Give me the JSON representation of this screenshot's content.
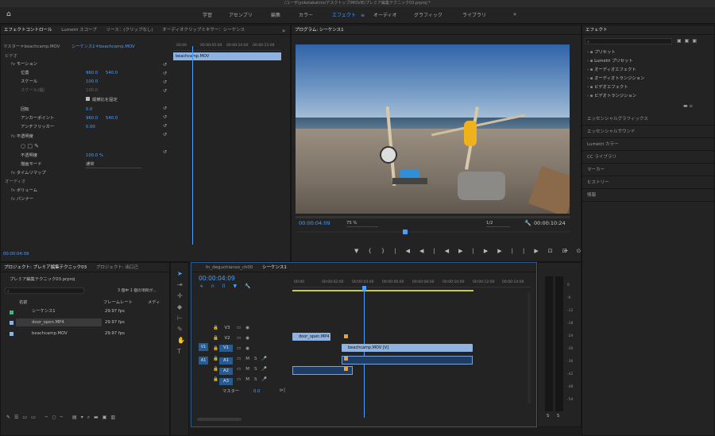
{
  "window": {
    "title": "/ユーザ/yokotakahiro/デスクトップ/MOVIE/プレミア編集テクニック03.prproj *"
  },
  "workspaces": [
    {
      "label": "学習",
      "active": false
    },
    {
      "label": "アセンブリ",
      "active": false
    },
    {
      "label": "編集",
      "active": false
    },
    {
      "label": "カラー",
      "active": false
    },
    {
      "label": "エフェクト",
      "active": true
    },
    {
      "label": "オーディオ",
      "active": false
    },
    {
      "label": "グラフィック",
      "active": false
    },
    {
      "label": "ライブラリ",
      "active": false
    }
  ],
  "effect_controls": {
    "tabs": [
      "エフェクトコントロール",
      "Lumetri スコープ",
      "ソース：(クリップなし)",
      "オーディオクリップミキサー：シーケンス"
    ],
    "source": "マスター＊beachcamp.MOV",
    "sequence": "シーケンス1＊beachcamp.MOV",
    "clip_label": "beachcamp.MOV",
    "ruler": [
      "00:00",
      "00:00:05:00",
      "00:00:10:00",
      "00:00:15:00"
    ],
    "rows": [
      {
        "label": "ビデオ"
      },
      {
        "label": "モーション"
      },
      {
        "label": "位置",
        "v1": "960.0",
        "v2": "540.0"
      },
      {
        "label": "スケール",
        "v1": "100.0"
      },
      {
        "label": "スケール(幅)",
        "v1": "100.0"
      },
      {
        "label": "縦横比を固定",
        "checkbox": true
      },
      {
        "label": "回転",
        "v1": "0.0"
      },
      {
        "label": "アンカーポイント",
        "v1": "960.0",
        "v2": "540.0"
      },
      {
        "label": "アンチフリッカー",
        "v1": "0.00"
      },
      {
        "label": "不透明度"
      },
      {
        "label": "不透明度",
        "v1": "100.0 %"
      },
      {
        "label": "描画モード",
        "v1": "通常"
      },
      {
        "label": "タイムリマップ"
      },
      {
        "label": "オーディオ"
      },
      {
        "label": "ボリューム"
      },
      {
        "label": "パンナー"
      }
    ],
    "timecode": "00:00:04:09"
  },
  "program": {
    "title": "プログラム: シーケンス1",
    "timecode": "00:00:04:09",
    "zoom": "75 %",
    "quality": "1/2",
    "duration": "00:00:10:24"
  },
  "effects": {
    "title": "エフェクト",
    "tree": [
      "プリセット",
      "Lumetri プリセット",
      "オーディオエフェクト",
      "オーディオトランジション",
      "ビデオエフェクト",
      "ビデオトランジション"
    ],
    "sections": [
      "エッセンシャルグラフィックス",
      "エッセンシャルサウンド",
      "Lumetri カラー",
      "CC ライブラリ",
      "マーカー",
      "ヒストリー",
      "情報"
    ]
  },
  "project": {
    "tabs": [
      "プロジェクト: プレミア編集テクニック03",
      "プロジェクト: 出口己"
    ],
    "file": "プレミア編集テクニック03.prproj",
    "items_info": "3 個中 1 個の項目が...",
    "columns": [
      "名前",
      "フレームレート",
      "メディ"
    ],
    "items": [
      {
        "name": "シーケンス1",
        "fps": "29.97 fps",
        "color": "#3fb87a"
      },
      {
        "name": "door_open.MP4",
        "fps": "29.97 fps",
        "color": "#8fb3e0"
      },
      {
        "name": "beachcamp.MOV",
        "fps": "29.97 fps",
        "color": "#8fb3e0"
      }
    ]
  },
  "timeline": {
    "tabs": [
      "fn_deguchianso_ch00",
      "シーケンス1"
    ],
    "timecode": "00:00:04:09",
    "ruler": [
      "00:00",
      "00:00:02:00",
      "00:00:04:00",
      "00:00:06:00",
      "00:00:08:00",
      "00:00:10:00",
      "00:00:12:00",
      "00:00:14:00"
    ],
    "tracks": [
      "V3",
      "V2",
      "V1",
      "A1",
      "A2",
      "A3"
    ],
    "clip_v2": "door_open.MP4 [V]",
    "clip_v1": "beachcamp.MOV [V]",
    "master": "マスター",
    "master_val": "0.0"
  },
  "meter": {
    "scale": [
      "0",
      "-6",
      "-12",
      "-18",
      "-24",
      "-30",
      "-36",
      "-42",
      "-48",
      "-54"
    ],
    "labels": [
      "S",
      "S"
    ]
  },
  "colors": {
    "accent": "#4a9eff",
    "panel": "#232323",
    "bg": "#1d1d1d"
  }
}
